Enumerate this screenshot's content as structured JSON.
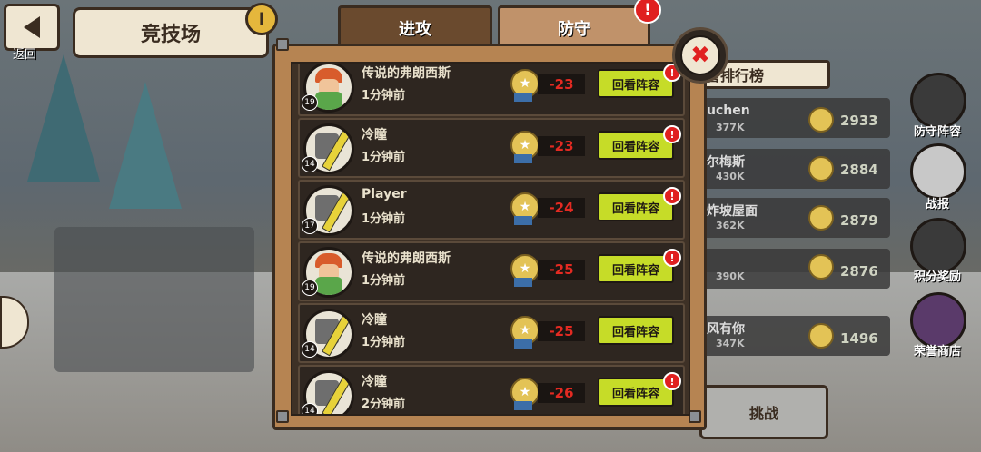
{
  "header": {
    "back_label": "返回",
    "title": "竞技场",
    "info_icon": "info-icon"
  },
  "tabs": [
    {
      "label": "进攻",
      "active": false
    },
    {
      "label": "防守",
      "active": true
    }
  ],
  "alert_glyph": "!",
  "close_glyph": "✖",
  "battle_log": [
    {
      "name": "传说的弗朗西斯",
      "time": "1分钟前",
      "level": "19",
      "score": "-23",
      "button": "回看阵容",
      "has_alert": true,
      "avatar": "hero-archer-icon"
    },
    {
      "name": "冷瞳",
      "time": "1分钟前",
      "level": "14",
      "score": "-23",
      "button": "回看阵容",
      "has_alert": true,
      "avatar": "knight-sword-icon"
    },
    {
      "name": "Player",
      "time": "1分钟前",
      "level": "17",
      "score": "-24",
      "button": "回看阵容",
      "has_alert": true,
      "avatar": "knight-sword-icon"
    },
    {
      "name": "传说的弗朗西斯",
      "time": "1分钟前",
      "level": "19",
      "score": "-25",
      "button": "回看阵容",
      "has_alert": true,
      "avatar": "hero-archer-icon"
    },
    {
      "name": "冷瞳",
      "time": "1分钟前",
      "level": "14",
      "score": "-25",
      "button": "回看阵容",
      "has_alert": false,
      "avatar": "knight-sword-icon"
    },
    {
      "name": "冷瞳",
      "time": "2分钟前",
      "level": "14",
      "score": "-26",
      "button": "回看阵容",
      "has_alert": true,
      "avatar": "knight-sword-icon"
    }
  ],
  "background_ranking": {
    "banner": "誉排行榜",
    "rows": [
      {
        "name": "uchen",
        "sub": "377K",
        "score": "2933"
      },
      {
        "name": "尔梅斯",
        "sub": "430K",
        "score": "2884"
      },
      {
        "name": "炸坡屋面",
        "sub": "362K",
        "score": "2879"
      },
      {
        "name": "",
        "sub": "390K",
        "score": "2876"
      },
      {
        "name": "风有你",
        "sub": "347K",
        "score": "1496"
      }
    ],
    "challenge": "挑战"
  },
  "side_menu": [
    {
      "label": "防守阵容",
      "icon": "shield-icon"
    },
    {
      "label": "战报",
      "icon": "battle-report-icon"
    },
    {
      "label": "积分奖励",
      "icon": "reward-icon"
    },
    {
      "label": "荣誉商店",
      "icon": "shop-icon"
    }
  ],
  "colors": {
    "panel": "#b68452",
    "row_bg": "#2e2620",
    "score_red": "#e32a22",
    "review_green": "#c6dc28",
    "alert_red": "#e02020"
  }
}
